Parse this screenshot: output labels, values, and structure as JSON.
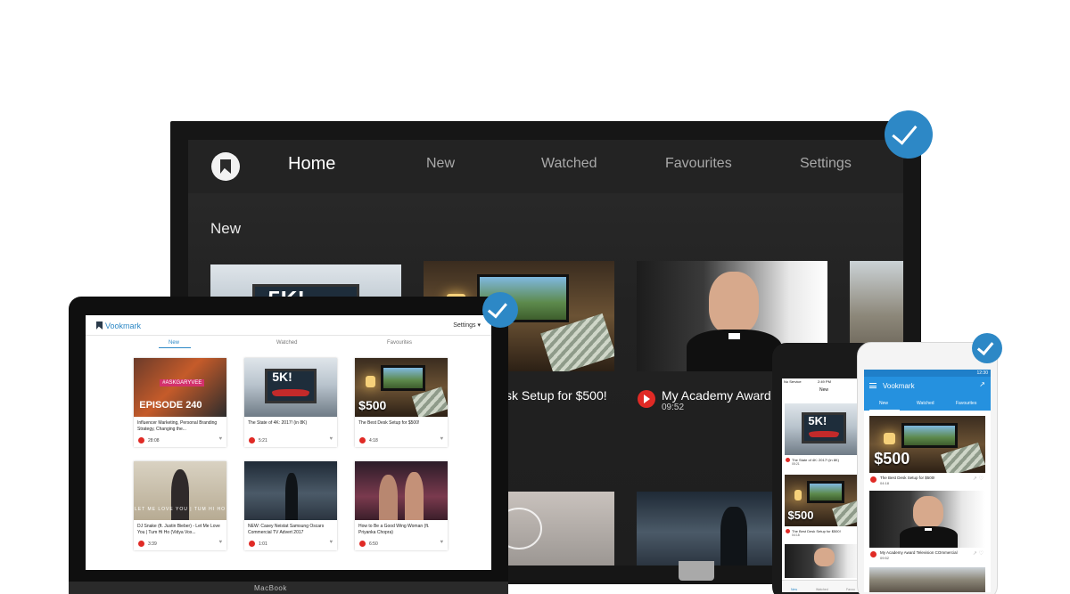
{
  "colors": {
    "accent": "#2d88c6",
    "youtube_red": "#e02a25",
    "android_bar": "#2591df",
    "tv_bg": "#232323"
  },
  "tv": {
    "nav": [
      {
        "label": "Home",
        "active": true
      },
      {
        "label": "New",
        "active": false
      },
      {
        "label": "Watched",
        "active": false
      },
      {
        "label": "Favourites",
        "active": false
      },
      {
        "label": "Settings",
        "active": false
      }
    ],
    "section_title": "New",
    "videos": [
      {
        "title": "sk Setup for $500!"
      },
      {
        "title": "My Academy Award Te",
        "duration": "09:52"
      }
    ],
    "thumb_labels": {
      "five_k": "5K!"
    }
  },
  "laptop": {
    "brand": "Vookmark",
    "settings_label": "Settings",
    "settings_icon": "caret-down-icon",
    "tabs": [
      {
        "label": "New",
        "active": true
      },
      {
        "label": "Watched",
        "active": false
      },
      {
        "label": "Favourites",
        "active": false
      }
    ],
    "cards": [
      {
        "title": "Influencer Marketing, Personal Branding Strategy, Changing the...",
        "duration": "28:08",
        "thumb_label": "EPISODE 240",
        "thumb_tag": "#ASKGARYVEE"
      },
      {
        "title": "The State of 4K: 2017! (in 8K)",
        "duration": "5:21",
        "thumb_label": "5K!"
      },
      {
        "title": "The Best Desk Setup for $500!",
        "duration": "4:18",
        "thumb_label": "$500"
      },
      {
        "title": "DJ Snake (ft. Justin Bieber) - Let Me Love You | Tum Hi Ho (Vidya Vox...",
        "duration": "3:39",
        "thumb_label": "LET ME LOVE YOU | TUM HI HO"
      },
      {
        "title": "NEW: Casey Neistat Samsung Oscars Commercial TV Advert 2017",
        "duration": "1:01"
      },
      {
        "title": "How to Be a Good Wing Woman (ft. Priyanka Chopra)",
        "duration": "6:50"
      }
    ],
    "device_label": "MacBook"
  },
  "iphone": {
    "status_left": "No Service",
    "time": "2:49 PM",
    "title": "New",
    "cards": [
      {
        "title": "The State of 4K: 2017! (in 8K)",
        "duration": "05:21",
        "thumb_label": "5K!"
      },
      {
        "title": "The Best Desk Setup for $500!",
        "duration": "04:18",
        "thumb_label": "$500"
      }
    ],
    "tabs": [
      {
        "label": "New"
      },
      {
        "label": "Watched"
      },
      {
        "label": "Favou"
      }
    ]
  },
  "android": {
    "time": "12:30",
    "title": "Vookmark",
    "menu_icon": "hamburger-icon",
    "share_icon": "share-icon",
    "tabs": [
      {
        "label": "New",
        "active": true
      },
      {
        "label": "Watched",
        "active": false
      },
      {
        "label": "Favourites",
        "active": false
      }
    ],
    "cards": [
      {
        "title": "The Best Desk Setup for $500!",
        "duration": "04:18",
        "thumb_label": "$500"
      },
      {
        "title": "My Academy Award Television COmmercial",
        "duration": "09:52"
      }
    ]
  }
}
